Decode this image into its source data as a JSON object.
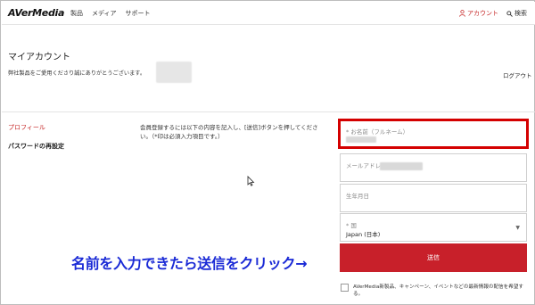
{
  "header": {
    "logo": "AVerMedia",
    "nav": [
      "製品",
      "メディア",
      "サポート"
    ],
    "account_label": "アカウント",
    "search_label": "検索",
    "colors": {
      "accent": "#c62828"
    }
  },
  "main": {
    "title": "マイアカウント",
    "thanks": "弊社製品をご愛用くださり誠にありがとうございます。",
    "logout": "ログアウト"
  },
  "sidebar": {
    "items": [
      {
        "label": "プロフィール",
        "active": true
      },
      {
        "label": "パスワードの再設定",
        "active": false
      }
    ]
  },
  "form": {
    "instructions": "会員登録するには以下の内容を記入し、[送信]ボタンを押してください。（*印は必須入力項目です。）",
    "name_label": "* お名前（フルネーム）",
    "email_label": "メールアドレス",
    "birth_label": "生年月日",
    "country_label": "* 国",
    "country_value": "Japan (日本)",
    "submit_label": "送信",
    "consent_text": "AVerMedia新製品、キャンペーン、イベントなどの最新情報の配信を希望する。"
  },
  "annotation": {
    "callout": "名前を入力できたら送信をクリック→",
    "highlight_color": "#d40000",
    "callout_color": "#1a2ad6"
  },
  "icons": [
    "person-icon",
    "search-icon",
    "chevron-down-icon",
    "cursor-icon"
  ]
}
